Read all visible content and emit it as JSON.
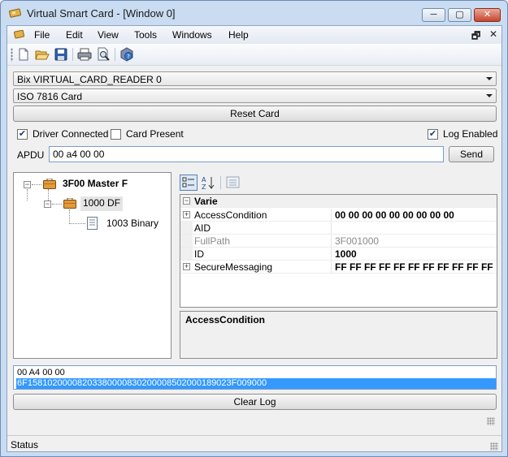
{
  "window": {
    "title": "Virtual Smart Card - [Window 0]",
    "min": "─",
    "max": "▢",
    "close": "✕"
  },
  "menu": {
    "items": [
      "File",
      "Edit",
      "View",
      "Tools",
      "Windows",
      "Help"
    ],
    "mdi_restore": "🗗",
    "mdi_close": "✕"
  },
  "toolbar": {
    "icons": [
      "new-icon",
      "open-icon",
      "save-icon",
      "print-icon",
      "print-preview-icon",
      "help-icon"
    ]
  },
  "reader_combo": {
    "value": "Bix VIRTUAL_CARD_READER 0"
  },
  "card_combo": {
    "value": "ISO 7816 Card"
  },
  "reset_button": {
    "label": "Reset Card"
  },
  "checkboxes": {
    "driver_connected": {
      "label": "Driver Connected",
      "checked": true,
      "mark": "✔"
    },
    "card_present": {
      "label": "Card Present",
      "checked": false,
      "mark": ""
    },
    "log_enabled": {
      "label": "Log Enabled",
      "checked": true,
      "mark": "✔"
    }
  },
  "apdu": {
    "label": "APDU",
    "value": "00 a4 00 00",
    "send_label": "Send"
  },
  "tree": {
    "nodes": [
      {
        "label": "3F00 Master F",
        "expander": "−"
      },
      {
        "label": "1000 DF",
        "expander": "−"
      },
      {
        "label": "1003 Binary"
      }
    ]
  },
  "property_grid": {
    "category": {
      "label": "Varie",
      "expander": "−"
    },
    "rows": [
      {
        "name": "AccessCondition",
        "value": "00 00 00 00 00 00 00 00 00",
        "expander": "+",
        "value_bold": true,
        "gray": false
      },
      {
        "name": "AID",
        "value": "",
        "expander": "",
        "value_bold": false,
        "gray": false
      },
      {
        "name": "FullPath",
        "value": "3F001000",
        "expander": "",
        "value_bold": false,
        "gray": true
      },
      {
        "name": "ID",
        "value": "1000",
        "expander": "",
        "value_bold": true,
        "gray": false
      },
      {
        "name": "SecureMessaging",
        "value": "FF FF FF FF FF FF FF FF FF FF FF FF FF",
        "expander": "+",
        "value_bold": true,
        "gray": false
      }
    ],
    "description_title": "AccessCondition"
  },
  "log": {
    "lines": [
      "00 A4 00 00",
      "6F15810200008203380000830200008502000189023F009000"
    ]
  },
  "clear_log_button": {
    "label": "Clear Log"
  },
  "status": {
    "text": "Status"
  },
  "colors": {
    "selection": "#3399ff",
    "titlebar": "#c9dcf1"
  }
}
